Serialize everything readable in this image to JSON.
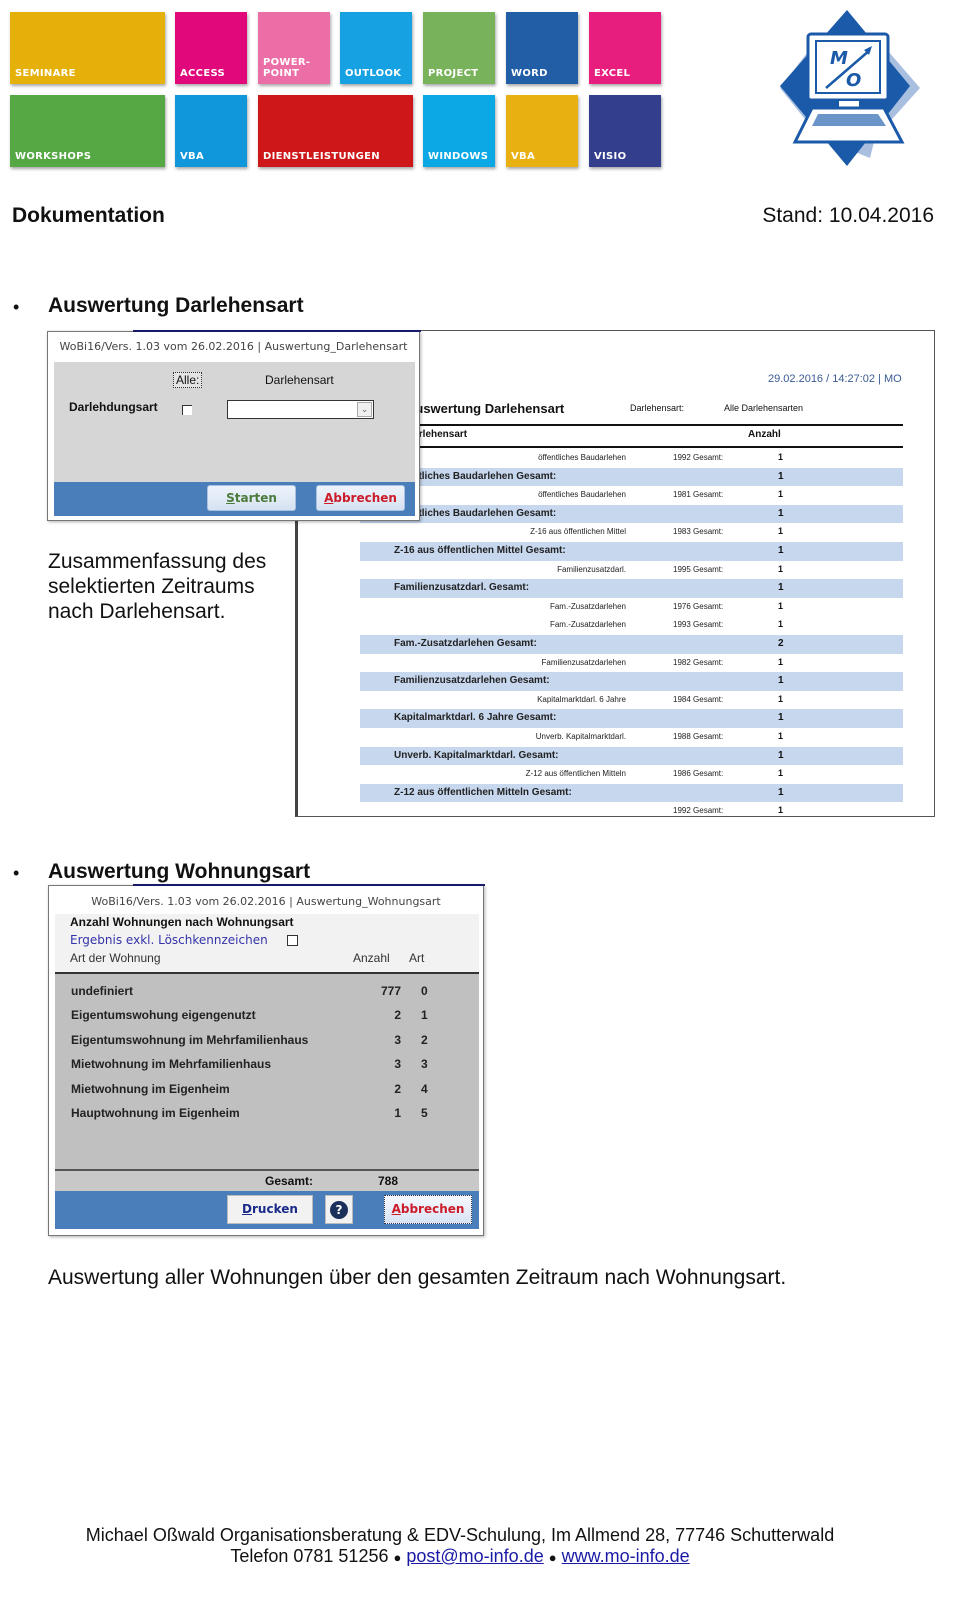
{
  "header": {
    "tiles": [
      {
        "label": "SEMINARE",
        "color": "#e6b00a"
      },
      {
        "label": "ACCESS",
        "color": "#e0087a"
      },
      {
        "label": "POWER-\nPOINT",
        "color": "#ec6ea6"
      },
      {
        "label": "OUTLOOK",
        "color": "#15a1e2"
      },
      {
        "label": "PROJECT",
        "color": "#78b25a"
      },
      {
        "label": "WORD",
        "color": "#215ea6"
      },
      {
        "label": "EXCEL",
        "color": "#e81e7e"
      },
      {
        "label": "WORKSHOPS",
        "color": "#55a844"
      },
      {
        "label": "VBA",
        "color": "#0f96db"
      },
      {
        "label": "DIENSTLEISTUNGEN",
        "color": "#cd1719"
      },
      {
        "label": "WINDOWS",
        "color": "#0ca8e6"
      },
      {
        "label": "VBA",
        "color": "#e8b010"
      },
      {
        "label": "VISIO",
        "color": "#333f8c"
      }
    ],
    "logo_text": "M/O"
  },
  "doc": {
    "title": "Dokumentation",
    "date": "Stand: 10.04.2016"
  },
  "section1": {
    "bullet": "•",
    "title": "Auswertung Darlehensart",
    "description": "Zusammenfassung des selektierten Zeitraums nach Darlehensart.",
    "dialog": {
      "title": "WoBi16/Vers. 1.03 vom 26.02.2016 | Auswertung_Darlehensart",
      "alle_label": "Alle:",
      "column_label": "Darlehensart",
      "field_label": "Darlehdungsart",
      "checkbox_checked": false,
      "combo_value": "",
      "combo_arrow": "⌄",
      "start_button": "tarten",
      "start_button_key": "S",
      "cancel_button": "bbrechen",
      "cancel_button_key": "A",
      "start_color": "#4b7a3a",
      "cancel_color": "#cc1c2a"
    },
    "report": {
      "stamp": "29.02.2016 / 14:27:02 | MO",
      "heading": "Auswertung Darlehensart",
      "filter_label": "Darlehensart:",
      "filter_value": "Alle Darlehensarten",
      "col_type": "Darlehensart",
      "col_count": "Anzahl",
      "rows": [
        {
          "kind": "detail",
          "name": "öffentliches Baudarlehen",
          "year": "1992 Gesamt:",
          "count": "1"
        },
        {
          "kind": "sum",
          "name": "öffentliches Baudarlehen Gesamt:",
          "count": "1"
        },
        {
          "kind": "detail",
          "name": "öffentliches Baudarlehen",
          "year": "1981 Gesamt:",
          "count": "1"
        },
        {
          "kind": "sum",
          "name": "öffentliches Baudarlehen Gesamt:",
          "count": "1"
        },
        {
          "kind": "detail",
          "name": "Z-16 aus öffentlichen Mittel",
          "year": "1983 Gesamt:",
          "count": "1"
        },
        {
          "kind": "sum",
          "name": "Z-16 aus öffentlichen Mittel Gesamt:",
          "count": "1"
        },
        {
          "kind": "detail",
          "name": "Familienzusatzdarl.",
          "year": "1995 Gesamt:",
          "count": "1"
        },
        {
          "kind": "sum",
          "name": "Familienzusatzdarl. Gesamt:",
          "count": "1"
        },
        {
          "kind": "detail",
          "name": "Fam.-Zusatzdarlehen",
          "year": "1976 Gesamt:",
          "count": "1"
        },
        {
          "kind": "detail",
          "name": "Fam.-Zusatzdarlehen",
          "year": "1993 Gesamt:",
          "count": "1"
        },
        {
          "kind": "sum",
          "name": "Fam.-Zusatzdarlehen Gesamt:",
          "count": "2"
        },
        {
          "kind": "detail",
          "name": "Familienzusatzdarlehen",
          "year": "1982 Gesamt:",
          "count": "1"
        },
        {
          "kind": "sum",
          "name": "Familienzusatzdarlehen Gesamt:",
          "count": "1"
        },
        {
          "kind": "detail",
          "name": "Kapitalmarktdarl. 6 Jahre",
          "year": "1984 Gesamt:",
          "count": "1"
        },
        {
          "kind": "sum",
          "name": "Kapitalmarktdarl. 6 Jahre Gesamt:",
          "count": "1"
        },
        {
          "kind": "detail",
          "name": "Unverb. Kapitalmarktdarl.",
          "year": "1988 Gesamt:",
          "count": "1"
        },
        {
          "kind": "sum",
          "name": "Unverb. Kapitalmarktdarl. Gesamt:",
          "count": "1"
        },
        {
          "kind": "detail",
          "name": "Z-12 aus öffentlichen Mitteln",
          "year": "1986 Gesamt:",
          "count": "1"
        },
        {
          "kind": "sum",
          "name": "Z-12 aus öffentlichen Mitteln Gesamt:",
          "count": "1"
        },
        {
          "kind": "detail",
          "name": "",
          "year": "1992 Gesamt:",
          "count": "1"
        }
      ]
    }
  },
  "section2": {
    "bullet": "•",
    "title": "Auswertung Wohnungsart",
    "description": "Auswertung aller Wohnungen über den gesamten Zeitraum nach Wohnungsart.",
    "dialog": {
      "title": "WoBi16/Vers. 1.03 vom 26.02.2016 | Auswertung_Wohnungsart",
      "heading": "Anzahl Wohnungen nach Wohnungsart",
      "exclude_label": "Ergebnis exkl. Löschkennzeichen",
      "exclude_checked": false,
      "col_type": "Art der Wohnung",
      "col_count": "Anzahl",
      "col_code": "Art",
      "rows": [
        {
          "name": "undefiniert",
          "count": "777",
          "code": "0"
        },
        {
          "name": "Eigentumswohung eigengenutzt",
          "count": "2",
          "code": "1"
        },
        {
          "name": "Eigentumswohnung im Mehrfamilienhaus",
          "count": "3",
          "code": "2"
        },
        {
          "name": "Mietwohnung im Mehrfamilienhaus",
          "count": "3",
          "code": "3"
        },
        {
          "name": "Mietwohnung im Eigenheim",
          "count": "2",
          "code": "4"
        },
        {
          "name": "Hauptwohnung im Eigenheim",
          "count": "1",
          "code": "5"
        }
      ],
      "total_label": "Gesamt:",
      "total_value": "788",
      "print_button_key": "D",
      "print_button": "rucken",
      "help_button": "?",
      "cancel_button_key": "A",
      "cancel_button": "bbrechen",
      "print_color": "#1a2a8a",
      "cancel_color": "#cc1c2a"
    }
  },
  "footer": {
    "line1": "Michael Oßwald Organisationsberatung & EDV-Schulung, Im Allmend 28, 77746 Schutterwald",
    "phone": "Telefon 0781 51256",
    "separator": "●",
    "email": "post@mo-info.de",
    "website": "www.mo-info.de"
  }
}
